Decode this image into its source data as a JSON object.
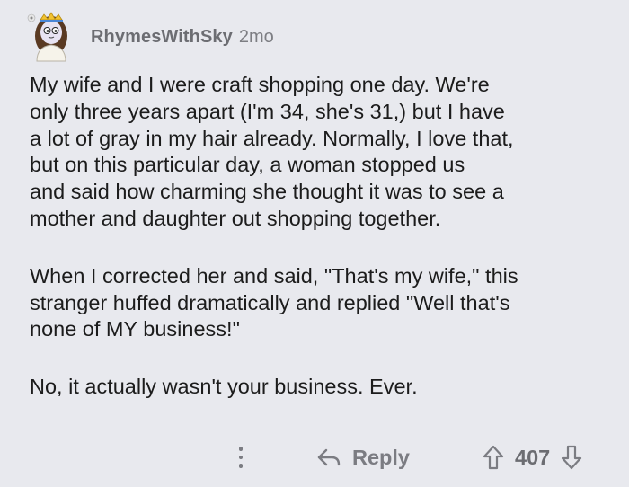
{
  "comment": {
    "username": "RhymesWithSky",
    "age": "2mo",
    "paragraphs": [
      "My wife and I were craft shopping one day. We're\nonly three years apart (I'm 34, she's 31,) but I have\na lot of gray in my hair already. Normally, I love that,\nbut on this particular day, a woman stopped us\nand said how charming she thought it was to see a\nmother and daughter out shopping together.",
      "When I corrected her and said, \"That's my wife,\" this\nstranger huffed dramatically and replied \"Well that's\nnone of MY business!\"",
      "No, it actually wasn't your business. Ever."
    ]
  },
  "actions": {
    "reply_label": "Reply",
    "score": "407"
  },
  "icons": {
    "more": "more-options-icon",
    "reply": "reply-arrow-icon",
    "upvote": "upvote-arrow-icon",
    "downvote": "downvote-arrow-icon"
  },
  "colors": {
    "background": "#e8e9ee",
    "text": "#1c1c1c",
    "muted": "#7b7c82"
  }
}
